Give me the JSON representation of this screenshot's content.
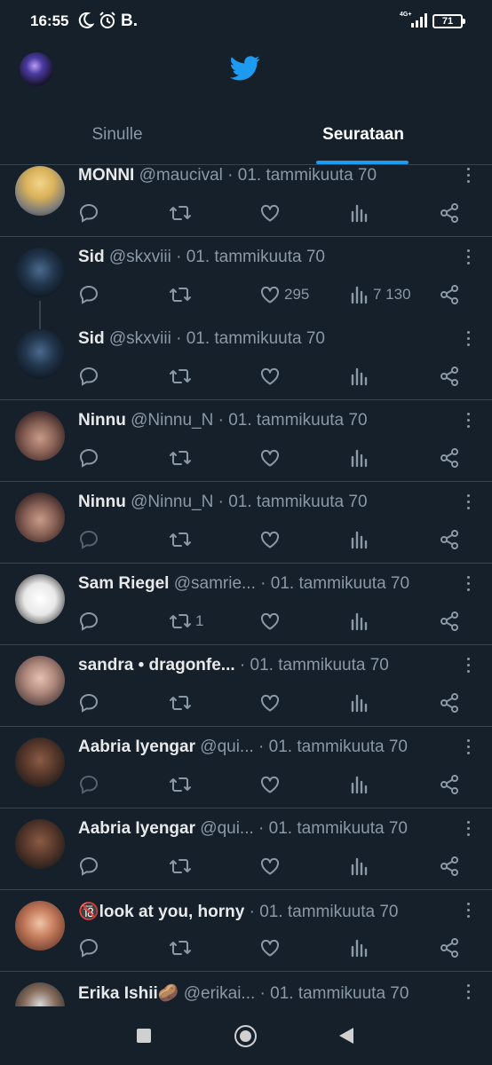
{
  "status_bar": {
    "time": "16:55",
    "carrier_badge": "B.",
    "network": "4G+",
    "battery": "71"
  },
  "tabs": [
    {
      "label": "Sinulle"
    },
    {
      "label": "Seurataan"
    }
  ],
  "feed": [
    {
      "name": "MONNI",
      "handle": "@maucival",
      "date": "01. tammikuuta 70",
      "likes": "",
      "views": "",
      "retweets": ""
    },
    {
      "name": "Sid",
      "handle": "@skxviii",
      "date": "01. tammikuuta 70",
      "likes": "295",
      "views": "7 130",
      "retweets": ""
    },
    {
      "name": "Sid",
      "handle": "@skxviii",
      "date": "01. tammikuuta 70",
      "likes": "",
      "views": "",
      "retweets": ""
    },
    {
      "name": "Ninnu",
      "handle": "@Ninnu_N",
      "date": "01. tammikuuta 70",
      "likes": "",
      "views": "",
      "retweets": ""
    },
    {
      "name": "Ninnu",
      "handle": "@Ninnu_N",
      "date": "01. tammikuuta 70",
      "likes": "",
      "views": "",
      "retweets": ""
    },
    {
      "name": "Sam Riegel",
      "handle": "@samrie...",
      "date": "01. tammikuuta 70",
      "likes": "",
      "views": "",
      "retweets": "1"
    },
    {
      "name": "sandra  •  dragonfe...",
      "handle": "",
      "date": "01. tammikuuta 70",
      "likes": "",
      "views": "",
      "retweets": ""
    },
    {
      "name": "Aabria Iyengar",
      "handle": "@qui...",
      "date": "01. tammikuuta 70",
      "likes": "",
      "views": "",
      "retweets": ""
    },
    {
      "name": "Aabria Iyengar",
      "handle": "@qui...",
      "date": "01. tammikuuta 70",
      "likes": "",
      "views": "",
      "retweets": ""
    },
    {
      "name": "🔞look at you, horny",
      "handle": "",
      "date": "01. tammikuuta 70",
      "likes": "",
      "views": "",
      "retweets": ""
    },
    {
      "name": "Erika Ishii🥔",
      "handle": "@erikai...",
      "date": "01. tammikuuta 70",
      "likes": "",
      "views": "",
      "retweets": ""
    }
  ],
  "colors": {
    "background": "#15202b",
    "accent": "#1d9bf0",
    "muted": "#8b98a5",
    "divider": "#38444d"
  },
  "icons": [
    "twitter-bird-icon",
    "moon-icon",
    "alarm-icon",
    "signal-icon",
    "reply-icon",
    "retweet-icon",
    "like-icon",
    "views-icon",
    "share-icon",
    "more-icon"
  ]
}
